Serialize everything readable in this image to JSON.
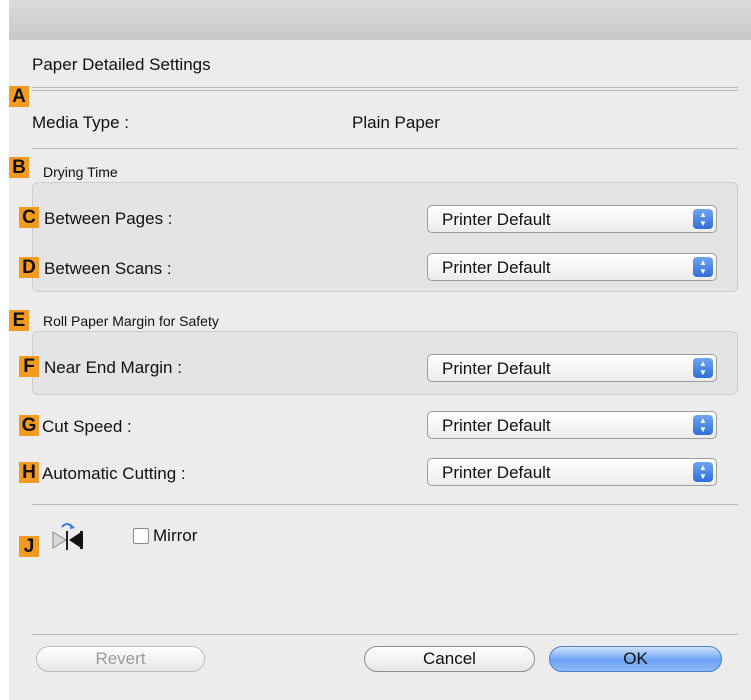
{
  "dialog": {
    "title": "Paper Detailed Settings"
  },
  "badges": {
    "a": "A",
    "b": "B",
    "c": "C",
    "d": "D",
    "e": "E",
    "f": "F",
    "g": "G",
    "h": "H",
    "j": "J"
  },
  "media": {
    "label": "Media Type :",
    "value": "Plain Paper"
  },
  "drying": {
    "group_label": "Drying Time",
    "between_pages_label": "Between Pages :",
    "between_pages_value": "Printer Default",
    "between_scans_label": "Between Scans :",
    "between_scans_value": "Printer Default"
  },
  "roll_margin": {
    "group_label": "Roll Paper Margin for Safety",
    "near_end_label": "Near End Margin :",
    "near_end_value": "Printer Default"
  },
  "cut": {
    "speed_label": "Cut Speed :",
    "speed_value": "Printer Default",
    "auto_label": "Automatic Cutting :",
    "auto_value": "Printer Default"
  },
  "mirror": {
    "label": "Mirror",
    "checked": false
  },
  "buttons": {
    "revert": "Revert",
    "cancel": "Cancel",
    "ok": "OK"
  },
  "colors": {
    "badge": "#f39a21",
    "ok_button": "#6aa3f4"
  }
}
